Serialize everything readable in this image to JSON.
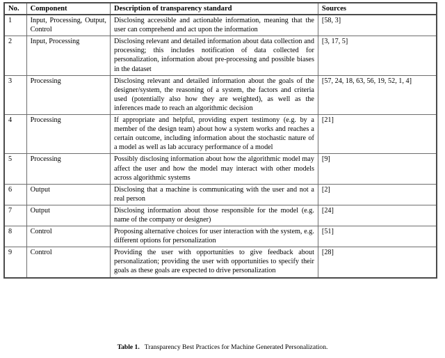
{
  "table": {
    "columns": [
      "No.",
      "Component",
      "Description of transparency standard",
      "Sources"
    ],
    "rows": [
      {
        "no": "1",
        "component": "Input, Processing, Output, Control",
        "description": "Disclosing accessible and actionable information, meaning that the user can comprehend and act upon the information",
        "sources": "[58, 3]"
      },
      {
        "no": "2",
        "component": "Input, Processing",
        "description": "Disclosing relevant and detailed information about data collection and processing; this includes notification of data collected for personalization, information about pre-processing and possible biases in the dataset",
        "sources": "[3, 17, 5]"
      },
      {
        "no": "3",
        "component": "Processing",
        "description": "Disclosing relevant and detailed information about the goals of the designer/system, the reasoning of a system, the factors and criteria used (potentially also how they are weighted), as well as the inferences made to reach an algorithmic decision",
        "sources": "[57, 24, 18, 63, 56, 19, 52, 1, 4]"
      },
      {
        "no": "4",
        "component": "Processing",
        "description": "If appropriate and helpful, providing expert testimony (e.g. by a member of the design team) about how a system works and reaches a certain outcome, including information about the stochastic nature of a model as well as lab accuracy performance of a model",
        "sources": "[21]"
      },
      {
        "no": "5",
        "component": "Processing",
        "description": "Possibly disclosing information about how the algorithmic model may affect the user and how the model may interact with other models across algorithmic systems",
        "sources": "[9]"
      },
      {
        "no": "6",
        "component": "Output",
        "description": "Disclosing that a machine is communicating with the user and not a real person",
        "sources": "[2]"
      },
      {
        "no": "7",
        "component": "Output",
        "description": "Disclosing information about those responsible for the model (e.g. name of the company or designer)",
        "sources": "[24]"
      },
      {
        "no": "8",
        "component": "Control",
        "description": "Proposing alternative choices for user interaction with the system, e.g. different options for personalization",
        "sources": "[51]"
      },
      {
        "no": "9",
        "component": "Control",
        "description": "Providing the user with opportunities to give feedback about personalization; providing the user with opportunities to specify their goals as these goals are expected to drive personalization",
        "sources": "[28]"
      }
    ]
  },
  "caption": {
    "label": "Table 1.",
    "text": "Transparency Best Practices for Machine Generated Personalization."
  },
  "colors": {
    "rule_heavy": "#4a4a4a",
    "rule_light": "#6d6d6d",
    "text": "#000000",
    "background": "#ffffff"
  }
}
